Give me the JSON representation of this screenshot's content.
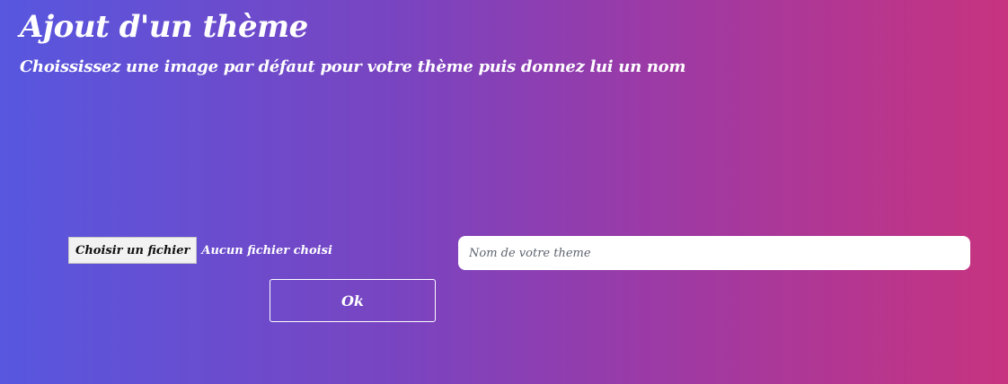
{
  "header": {
    "title": "Ajout d'un thème",
    "subtitle": "Choississez une image par défaut pour votre thème puis donnez lui un nom"
  },
  "form": {
    "file_button_label": "Choisir un fichier",
    "file_status": "Aucun fichier choisi",
    "theme_name_placeholder": "Nom de votre theme",
    "theme_name_value": "",
    "ok_label": "Ok"
  },
  "colors": {
    "gradient_start": "#5757df",
    "gradient_end": "#c7337f",
    "text": "#ffffff"
  }
}
